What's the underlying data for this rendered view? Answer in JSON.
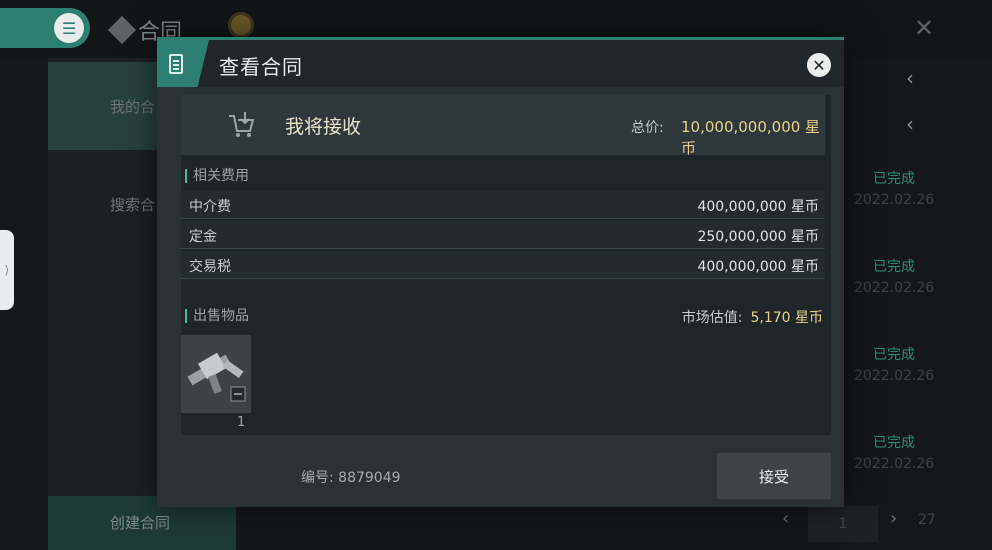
{
  "background": {
    "title": "合同",
    "left_items": [
      "我的合",
      "搜索合"
    ],
    "create_label": "创建合同",
    "statuses": [
      {
        "status": "已完成",
        "date": "2022.02.26"
      },
      {
        "status": "已完成",
        "date": "2022.02.26"
      },
      {
        "status": "已完成",
        "date": "2022.02.26"
      },
      {
        "status": "已完成",
        "date": "2022.02.26"
      }
    ],
    "pager": {
      "page": "1",
      "total": "27"
    }
  },
  "modal": {
    "title": "查看合同",
    "receive_label": "我将接收",
    "total_label": "总价:",
    "total_value": "10,000,000,000 星币",
    "fees_title": "相关费用",
    "fees": [
      {
        "name": "中介费",
        "value": "400,000,000 星币"
      },
      {
        "name": "定金",
        "value": "250,000,000 星币"
      },
      {
        "name": "交易税",
        "value": "400,000,000 星币"
      }
    ],
    "sale_title": "出售物品",
    "market_label": "市场估值:",
    "market_value": "5,170 星币",
    "item_count": "1",
    "contract_id": "编号: 8879049",
    "accept_label": "接受"
  },
  "colors": {
    "accent": "#2d7f72",
    "gold": "#e9cf86",
    "completed": "#2c8e6a"
  }
}
